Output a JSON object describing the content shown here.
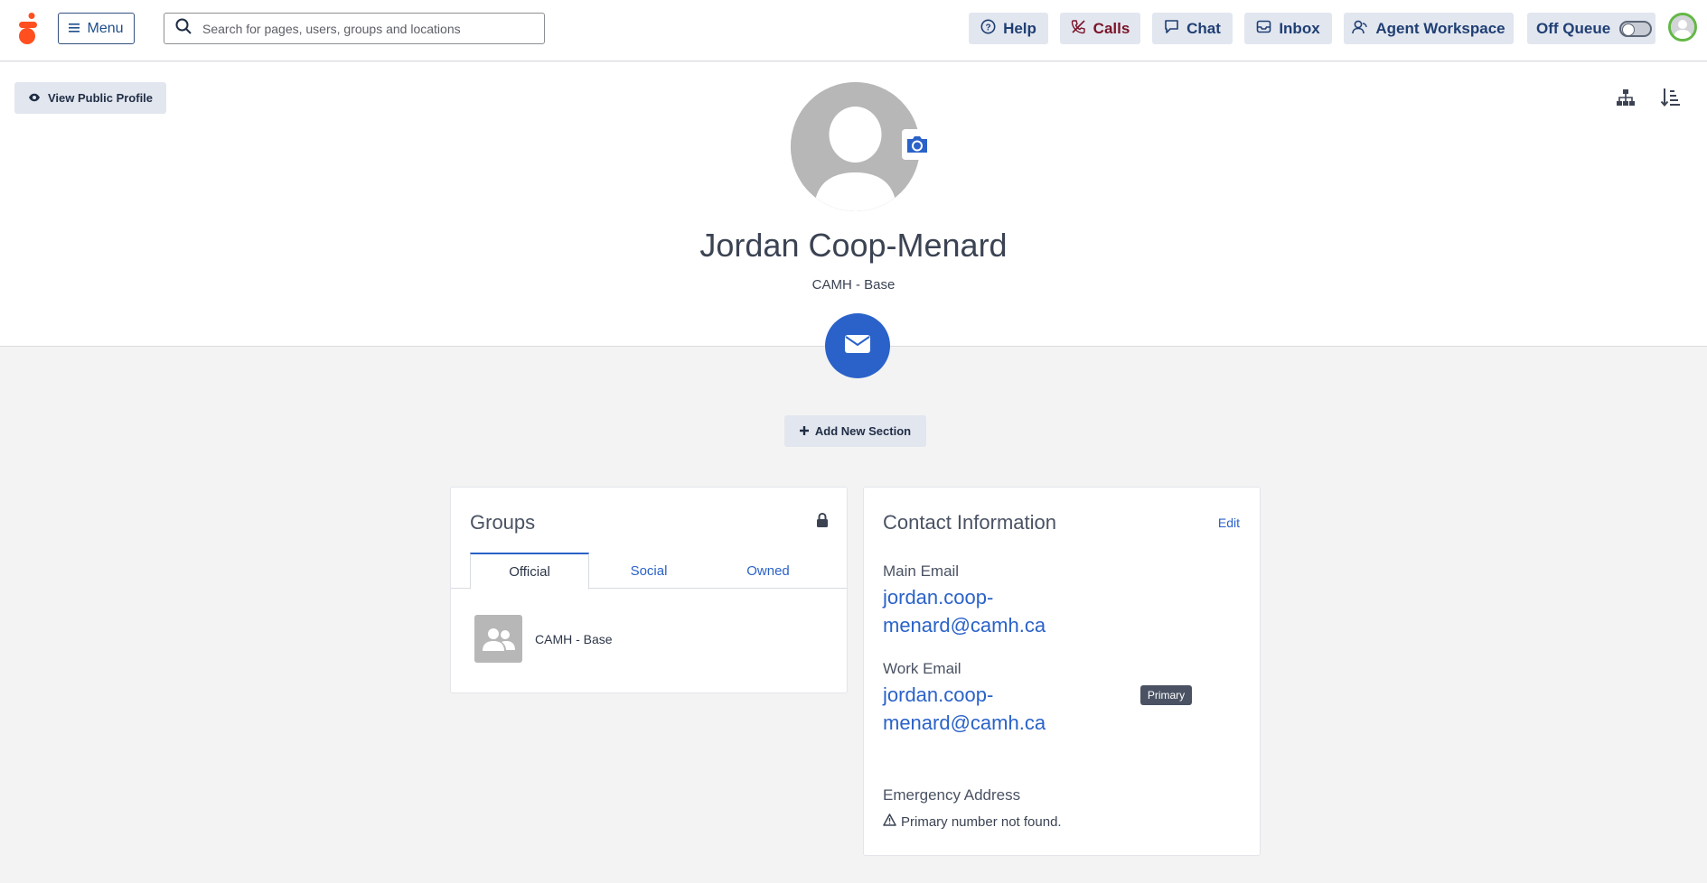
{
  "topbar": {
    "menu_label": "Menu",
    "search_placeholder": "Search for pages, users, groups and locations",
    "nav": {
      "help": "Help",
      "calls": "Calls",
      "chat": "Chat",
      "inbox": "Inbox",
      "agent_workspace": "Agent Workspace"
    },
    "queue_label": "Off Queue",
    "queue_on": false
  },
  "profile": {
    "view_public_label": "View Public Profile",
    "name": "Jordan Coop-Menard",
    "subtitle": "CAMH - Base",
    "add_section_label": "Add New Section"
  },
  "groups": {
    "title": "Groups",
    "tabs": [
      {
        "label": "Official",
        "active": true
      },
      {
        "label": "Social",
        "active": false
      },
      {
        "label": "Owned",
        "active": false
      }
    ],
    "items": [
      {
        "name": "CAMH - Base"
      }
    ]
  },
  "contact": {
    "title": "Contact Information",
    "edit_label": "Edit",
    "main_email_label": "Main Email",
    "main_email": "jordan.coop-menard@camh.ca",
    "work_email_label": "Work Email",
    "work_email": "jordan.coop-menard@camh.ca",
    "primary_badge": "Primary",
    "emergency_label": "Emergency Address",
    "emergency_warning": "Primary number not found."
  },
  "colors": {
    "accent": "#2a62c9",
    "logo": "#ff4f1f",
    "button_bg": "#e2e6ef",
    "nav_text": "#1f3f73",
    "calls_text": "#7a1428",
    "avatar_ring": "#63b845"
  },
  "icons": {
    "logo": "genesys-logo-icon",
    "menu": "hamburger-icon",
    "search": "search-icon",
    "help": "question-circle-icon",
    "calls": "phone-slash-icon",
    "chat": "chat-bubble-icon",
    "inbox": "inbox-tray-icon",
    "agent_workspace": "agent-headset-icon",
    "view": "eye-icon",
    "camera": "camera-icon",
    "org_chart": "org-chart-icon",
    "sort": "sort-list-icon",
    "email": "envelope-icon",
    "add": "plus-icon",
    "lock": "lock-icon",
    "group": "group-users-icon",
    "warning": "warning-triangle-icon"
  }
}
